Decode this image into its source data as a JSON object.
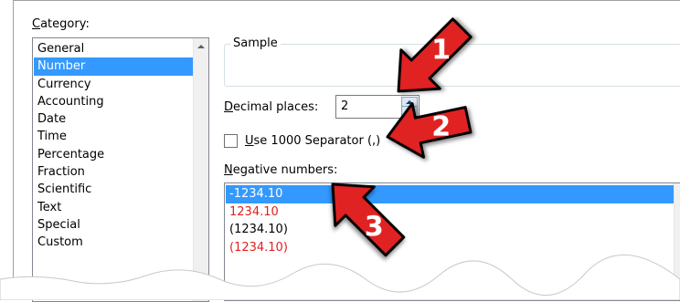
{
  "category": {
    "label_prefix": "C",
    "label_rest": "ategory:",
    "items": [
      "General",
      "Number",
      "Currency",
      "Accounting",
      "Date",
      "Time",
      "Percentage",
      "Fraction",
      "Scientific",
      "Text",
      "Special",
      "Custom"
    ],
    "selected": "Number"
  },
  "sample": {
    "legend": "Sample",
    "value": ""
  },
  "decimal": {
    "label_prefix": "D",
    "label_rest": "ecimal places:",
    "value": "2"
  },
  "separator": {
    "label_prefix": "U",
    "label_rest": "se 1000 Separator (,)",
    "checked": false
  },
  "negative": {
    "label_prefix": "N",
    "label_rest": "egative numbers:",
    "items": [
      "-1234.10",
      "1234.10",
      "(1234.10)",
      "(1234.10)"
    ],
    "item_colors": [
      "black",
      "red",
      "black",
      "red"
    ],
    "selected_index": 0
  },
  "callouts": [
    "1",
    "2",
    "3"
  ],
  "colors": {
    "selection": "#3399ff",
    "callout_arrow": "#e02020",
    "negative_red": "#e02020"
  }
}
